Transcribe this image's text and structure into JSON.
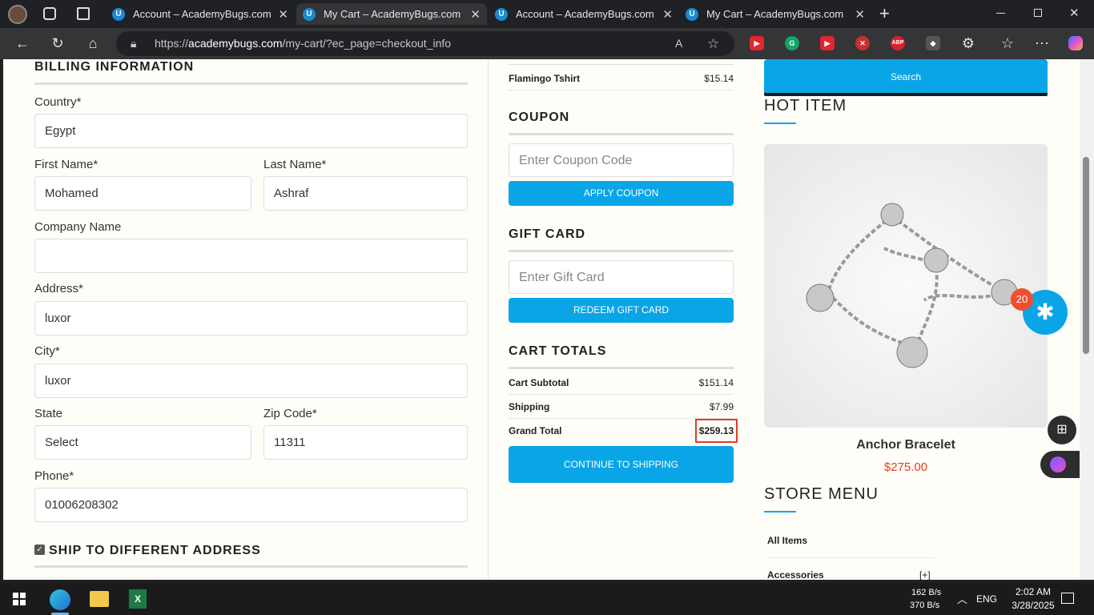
{
  "tabs": [
    {
      "title": "Account – AcademyBugs.com",
      "active": false
    },
    {
      "title": "My Cart – AcademyBugs.com",
      "active": true
    },
    {
      "title": "Account – AcademyBugs.com",
      "active": false
    },
    {
      "title": "My Cart – AcademyBugs.com",
      "active": false
    }
  ],
  "browser": {
    "url_prefix": "https://",
    "url_domain": "academybugs.com",
    "url_path": "/my-cart/?ec_page=checkout_info"
  },
  "billing": {
    "heading": "BILLING INFORMATION",
    "country_label": "Country*",
    "country_value": "Egypt",
    "first_name_label": "First Name*",
    "first_name_value": "Mohamed",
    "last_name_label": "Last Name*",
    "last_name_value": "Ashraf",
    "company_label": "Company Name",
    "company_value": "",
    "address_label": "Address*",
    "address_value": "luxor",
    "city_label": "City*",
    "city_value": "luxor",
    "state_label": "State",
    "state_value": "Select",
    "zip_label": "Zip Code*",
    "zip_value": "11311",
    "phone_label": "Phone*",
    "phone_value": "01006208302",
    "ship_different_label": "SHIP TO DIFFERENT ADDRESS"
  },
  "cart": {
    "item_name": "Flamingo Tshirt",
    "item_price": "$15.14",
    "coupon_heading": "COUPON",
    "coupon_placeholder": "Enter Coupon Code",
    "apply_coupon": "APPLY COUPON",
    "gift_heading": "GIFT CARD",
    "gift_placeholder": "Enter Gift Card",
    "redeem_gift": "REDEEM GIFT CARD",
    "totals_heading": "CART TOTALS",
    "subtotal_label": "Cart Subtotal",
    "subtotal_value": "$151.14",
    "shipping_label": "Shipping",
    "shipping_value": "$7.99",
    "grand_label": "Grand Total",
    "grand_value": "$259.13",
    "continue": "CONTINUE TO SHIPPING"
  },
  "sidebar": {
    "search_label": "Search",
    "hot_item_heading": "HOT ITEM",
    "product_name": "Anchor Bracelet",
    "product_price": "$275.00",
    "store_menu_heading": "STORE MENU",
    "menu": [
      {
        "label": "All Items"
      },
      {
        "label": "Accessories",
        "suffix": "[+]"
      }
    ],
    "bug_count": "20"
  },
  "taskbar": {
    "net_up": "162 B/s",
    "net_down": "370 B/s",
    "lang": "ENG",
    "time": "2:02 AM",
    "date": "3/28/2025"
  },
  "colors": {
    "accent": "#0aa5e6",
    "price": "#e2401c",
    "highlight": "#e23b2a"
  }
}
